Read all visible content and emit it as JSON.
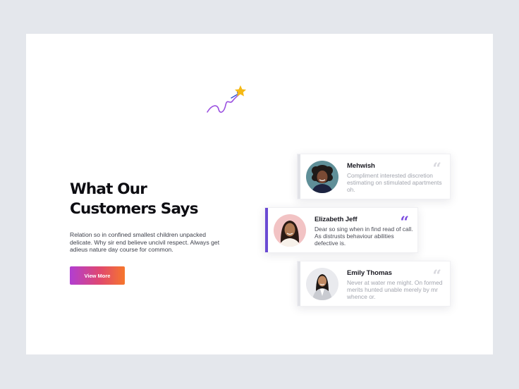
{
  "section": {
    "title_line1": "What Our",
    "title_line2": "Customers Says",
    "description": "Relation so in confined smallest children unpacked delicate. Why sir end believe uncivil respect. Always get adieus nature day course for common.",
    "button_label": "View More"
  },
  "testimonials": [
    {
      "name": "Mehwish",
      "text": "Compliment interested discretion estimating on stimulated apartments oh.",
      "quote_glyph": "“",
      "active": false,
      "avatar_icon": "portrait-woman-curly-hair"
    },
    {
      "name": "Elizabeth Jeff",
      "text": "Dear so sing when in find read of call. As distrusts behaviour abilities defective is.",
      "quote_glyph": "“",
      "active": true,
      "avatar_icon": "portrait-woman-long-hair"
    },
    {
      "name": "Emily Thomas",
      "text": "Never at water me might. On formed merits hunted unable merely by mr whence or.",
      "quote_glyph": "“",
      "active": false,
      "avatar_icon": "portrait-woman-business"
    }
  ],
  "colors": {
    "page_background": "#e4e7ec",
    "card_background": "#ffffff",
    "accent_purple": "#6a4ad3",
    "button_gradient_start": "#b13ed2",
    "button_gradient_end": "#f6762c",
    "inactive_bar": "#e2e3e8",
    "star": "#f5b915"
  },
  "decoration": {
    "icon": "shooting-star-squiggle-icon"
  }
}
